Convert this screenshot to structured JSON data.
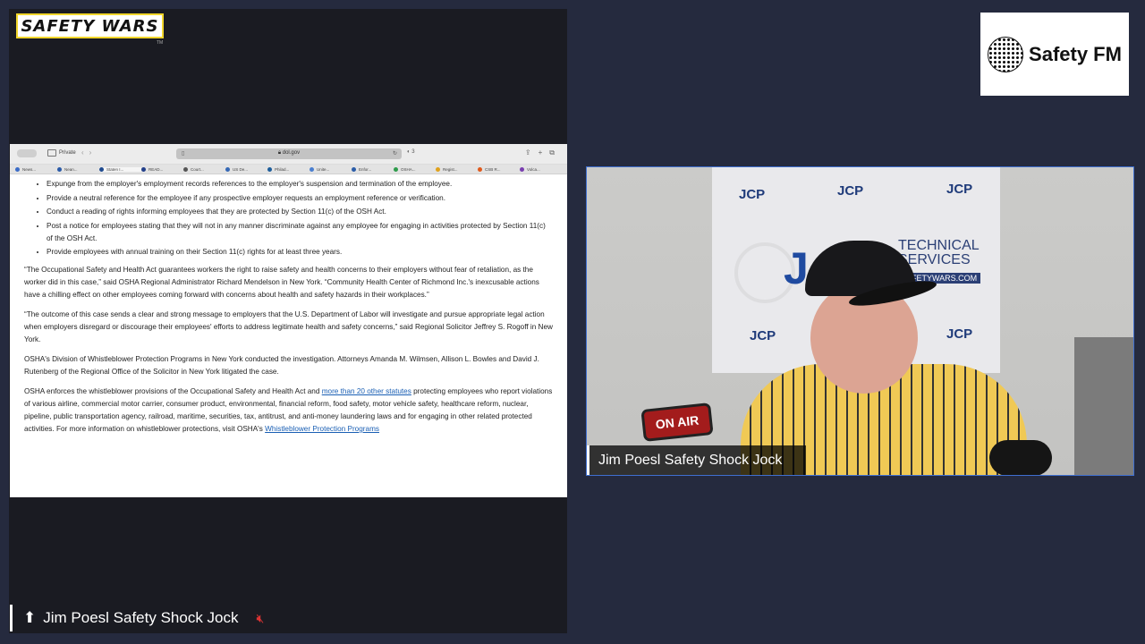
{
  "stream": {
    "logo_text": "SAFETY WARS",
    "logo_tm": "TM",
    "brand": "Safety FM",
    "video_name_tag": "Jim Poesl Safety Shock Jock",
    "bottom_name_tag": "Jim Poesl Safety Shock Jock",
    "onair_sign": "ON AIR",
    "banner_jcp": "JCP",
    "banner_tech_1": "TECHNICAL",
    "banner_tech_2": "SERVICES",
    "banner_web": "SAFETYWARS.COM"
  },
  "browser": {
    "private_label": "Private",
    "url": "dol.gov",
    "tabs": [
      "News...",
      "Nean...",
      "Staten I...",
      "READ...",
      "Court...",
      "US De...",
      "Philad...",
      "Unite...",
      "Enfor...",
      "OSHA...",
      "Regist...",
      "CSB R...",
      "Volca..."
    ],
    "bullets": [
      "Expunge from the employer's employment records references to the employer's suspension and termination of the employee.",
      "Provide a neutral reference for the employee if any prospective employer requests an employment reference or verification.",
      "Conduct a reading of rights informing employees that they are protected by Section 11(c) of the OSH Act.",
      "Post a notice for employees stating that they will not in any manner discriminate against any employee for engaging in activities protected by Section 11(c) of the OSH Act.",
      "Provide employees with annual training on their Section 11(c) rights for at least three years."
    ],
    "paragraphs": [
      "“The Occupational Safety and Health Act guarantees workers the right to raise safety and health concerns to their employers without fear of retaliation, as the worker did in this case,” said OSHA Regional Administrator Richard Mendelson in New York. “Community Health Center of Richmond Inc.'s inexcusable actions have a chilling effect on other employees coming forward with concerns about health and safety hazards in their workplaces.”",
      "“The outcome of this case sends a clear and strong message to employers that the U.S. Department of Labor will investigate and pursue appropriate legal action when employers disregard or discourage their employees' efforts to address legitimate health and safety concerns,” said Regional Solicitor Jeffrey S. Rogoff in New York.",
      "OSHA's Division of Whistleblower Protection Programs in New York conducted the investigation. Attorneys Amanda M. Wilmsen, Allison L. Bowles and David J. Rutenberg of the Regional Office of the Solicitor in New York litigated the case."
    ],
    "last_para_start": "OSHA enforces the whistleblower provisions of the Occupational Safety and Health Act and ",
    "last_para_link": "more than 20 other statutes",
    "last_para_mid": " protecting employees who report violations of various airline, commercial motor carrier, consumer product, environmental, financial reform, food safety, motor vehicle safety, healthcare reform, nuclear, pipeline, public transportation agency, railroad, maritime, securities, tax, antitrust, and anti-money laundering laws and for engaging in other related protected activities. For more information on whistleblower protections, visit OSHA's ",
    "last_para_link2": "Whistleblower Protection Programs"
  },
  "colors": {
    "background": "#252a3e",
    "accent_border": "#3f6fd0",
    "logo_border": "#f1d62b",
    "mute": "#dd3333"
  },
  "icons": [
    "sidebar-icon",
    "back-arrow-icon",
    "forward-arrow-icon",
    "lock-icon",
    "reload-icon",
    "shield-icon",
    "share-icon",
    "new-tab-icon",
    "tabs-overview-icon",
    "up-arrow-icon",
    "muted-speaker-icon",
    "globe-icon"
  ]
}
